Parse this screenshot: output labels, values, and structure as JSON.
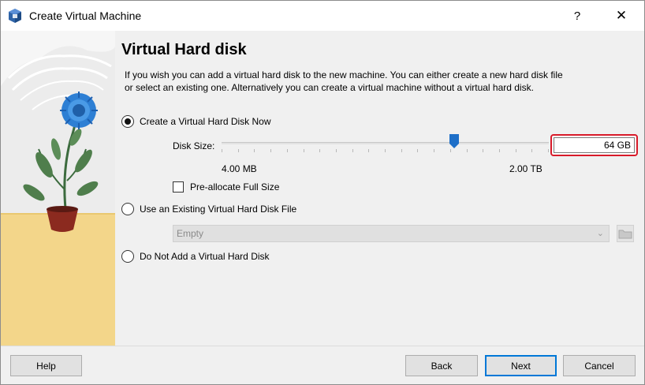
{
  "window": {
    "title": "Create Virtual Machine",
    "help_glyph": "?",
    "close_glyph": "✕"
  },
  "page": {
    "heading": "Virtual Hard disk",
    "description": "If you wish you can add a virtual hard disk to the new machine. You can either create a new hard disk file or select an existing one. Alternatively you can create a virtual machine without a virtual hard disk."
  },
  "options": {
    "create_new": {
      "label": "Create a Virtual Hard Disk Now",
      "selected": true
    },
    "use_existing": {
      "label": "Use an Existing Virtual Hard Disk File",
      "selected": false
    },
    "no_disk": {
      "label": "Do Not Add a Virtual Hard Disk",
      "selected": false
    }
  },
  "disk_size": {
    "label": "Disk Size:",
    "value": "64 GB",
    "min_label": "4.00 MB",
    "max_label": "2.00 TB",
    "slider_position": 0.71
  },
  "preallocate": {
    "label": "Pre-allocate Full Size",
    "checked": false
  },
  "existing_file": {
    "selected": "Empty"
  },
  "buttons": {
    "help": "Help",
    "back": "Back",
    "next": "Next",
    "cancel": "Cancel"
  },
  "colors": {
    "highlight_border": "#d81b2a",
    "default_button_border": "#0078d7",
    "slider_thumb": "#1e6fc8"
  },
  "icons": {
    "app": "virtualbox-icon",
    "folder": "folder-icon",
    "chevron": "chevron-down-icon"
  }
}
